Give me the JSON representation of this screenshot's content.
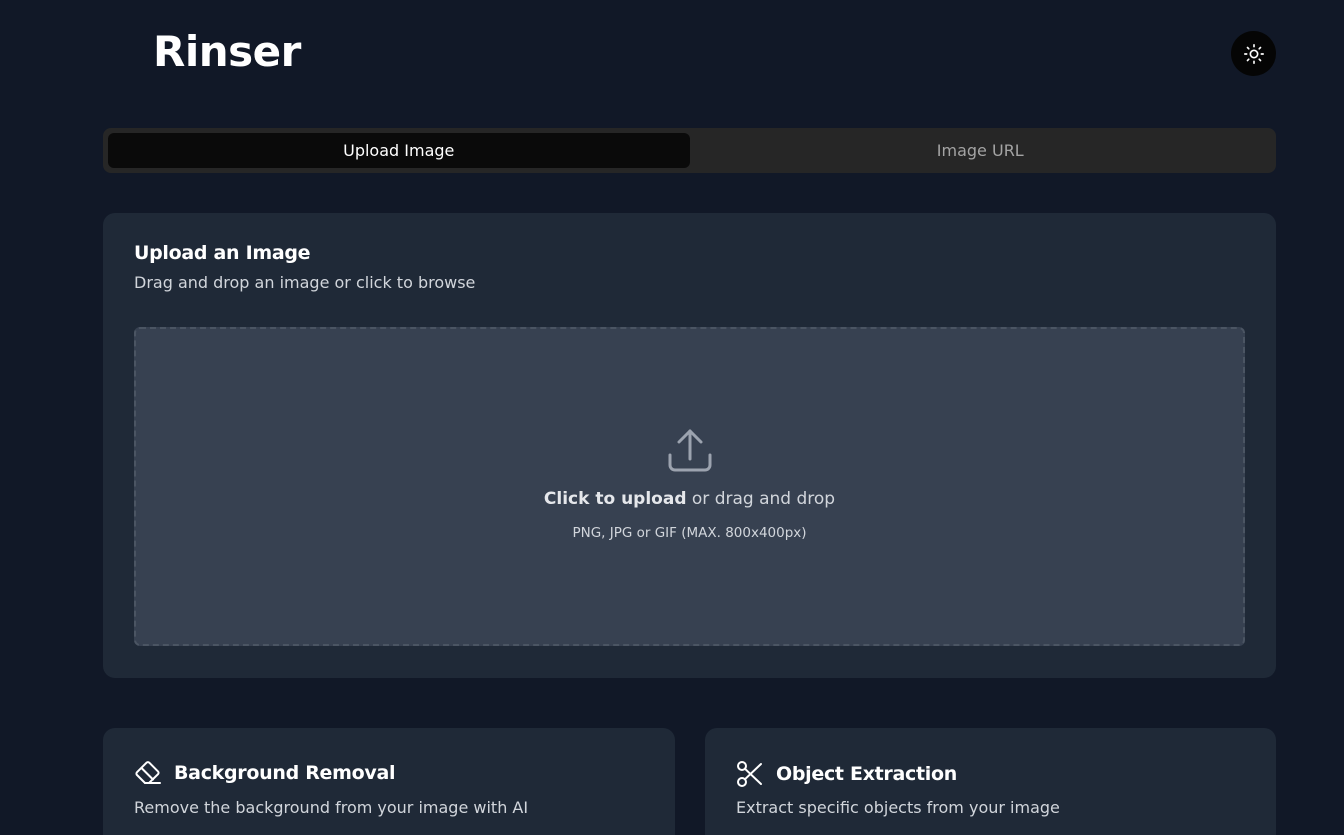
{
  "header": {
    "brand": "Rinser",
    "theme_toggle_icon": "sun-icon"
  },
  "tabs": [
    {
      "label": "Upload Image",
      "active": true
    },
    {
      "label": "Image URL",
      "active": false
    }
  ],
  "upload": {
    "title": "Upload an Image",
    "description": "Drag and drop an image or click to browse",
    "dropzone": {
      "icon": "upload-icon",
      "click_label": "Click to upload",
      "drag_label": " or drag and drop",
      "hint": "PNG, JPG or GIF (MAX. 800x400px)"
    }
  },
  "features": [
    {
      "icon": "eraser-icon",
      "title": "Background Removal",
      "description": "Remove the background from your image with AI"
    },
    {
      "icon": "scissors-icon",
      "title": "Object Extraction",
      "description": "Extract specific objects from your image"
    }
  ],
  "colors": {
    "page_bg": "#111827",
    "card_bg": "#1f2937",
    "dropzone_bg": "#374151",
    "tab_bar_bg": "#262626",
    "tab_active_bg": "#0a0a0a"
  }
}
